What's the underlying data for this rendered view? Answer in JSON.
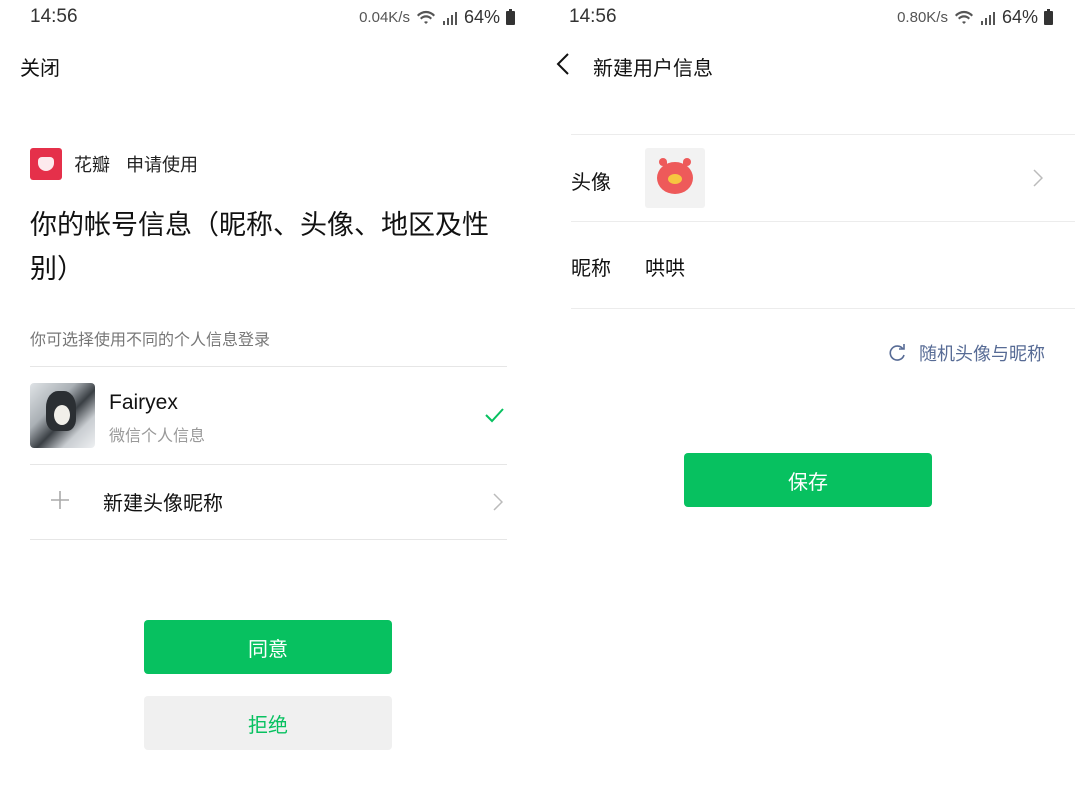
{
  "left": {
    "status": {
      "time": "14:56",
      "speed": "0.04K/s",
      "battery": "64%"
    },
    "close_label": "关闭",
    "app": {
      "name": "花瓣",
      "request": "申请使用",
      "brand_color": "#e5304a"
    },
    "scope_title": "你的帐号信息（昵称、头像、地区及性别）",
    "hint": "你可选择使用不同的个人信息登录",
    "account": {
      "name": "Fairyex",
      "subtitle": "微信个人信息",
      "selected": true
    },
    "new_profile_label": "新建头像昵称",
    "agree_label": "同意",
    "reject_label": "拒绝"
  },
  "right": {
    "status": {
      "time": "14:56",
      "speed": "0.80K/s",
      "battery": "64%"
    },
    "title": "新建用户信息",
    "avatar_label": "头像",
    "nickname_label": "昵称",
    "nickname_value": "哄哄",
    "random_label": "随机头像与昵称",
    "save_label": "保存"
  },
  "colors": {
    "primary": "#07c160",
    "link": "#576b95",
    "reject_bg": "#f0f0f0"
  },
  "icons": [
    "wifi-icon",
    "signal-icon",
    "battery-icon",
    "check-icon",
    "plus-icon",
    "chevron-right-icon",
    "back-arrow-icon",
    "refresh-icon"
  ]
}
